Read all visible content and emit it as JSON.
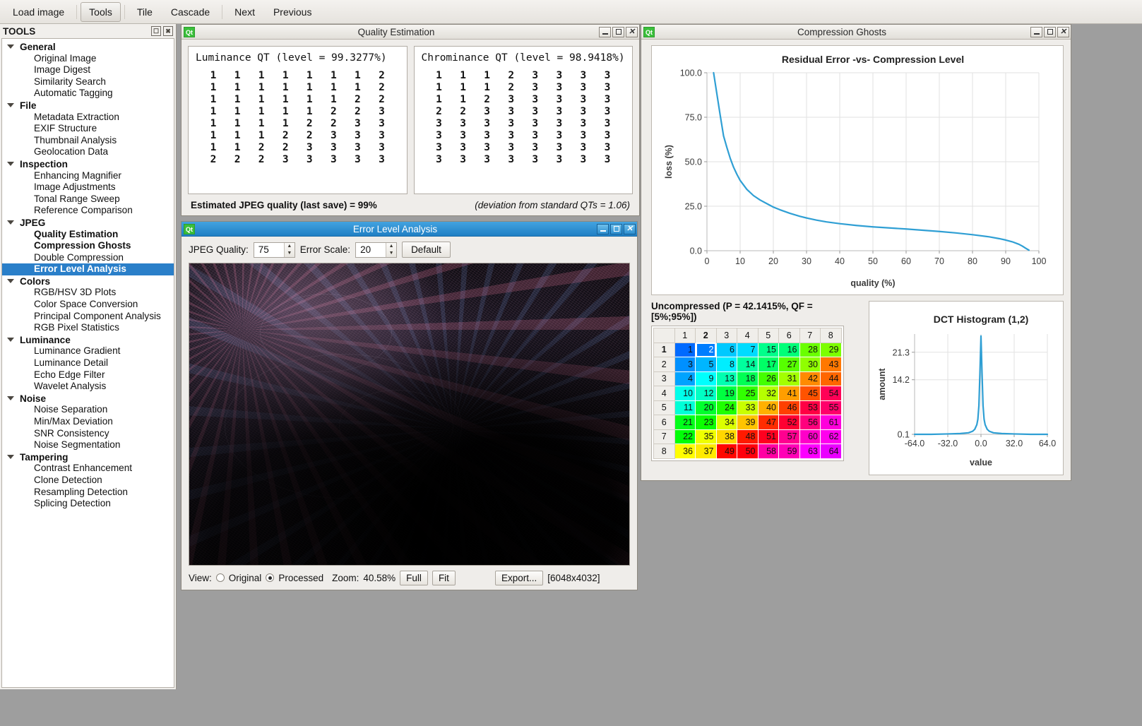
{
  "menubar": {
    "items": [
      {
        "label": "Load image",
        "active": false
      },
      {
        "label": "Tools",
        "active": true
      },
      {
        "label": "Tile",
        "active": false
      },
      {
        "label": "Cascade",
        "active": false
      },
      {
        "label": "Next",
        "active": false
      },
      {
        "label": "Previous",
        "active": false
      }
    ]
  },
  "tools_dock": {
    "title": "TOOLS",
    "float_icon": "float-icon",
    "close_icon": "close-icon",
    "groups": [
      {
        "name": "General",
        "items": [
          "Original Image",
          "Image Digest",
          "Similarity Search",
          "Automatic Tagging"
        ]
      },
      {
        "name": "File",
        "items": [
          "Metadata Extraction",
          "EXIF Structure",
          "Thumbnail Analysis",
          "Geolocation Data"
        ]
      },
      {
        "name": "Inspection",
        "items": [
          "Enhancing Magnifier",
          "Image Adjustments",
          "Tonal Range Sweep",
          "Reference Comparison"
        ]
      },
      {
        "name": "JPEG",
        "items": [
          "Quality Estimation",
          "Compression Ghosts",
          "Double Compression",
          "Error Level Analysis"
        ]
      },
      {
        "name": "Colors",
        "items": [
          "RGB/HSV 3D Plots",
          "Color Space Conversion",
          "Principal Component Analysis",
          "RGB Pixel Statistics"
        ]
      },
      {
        "name": "Luminance",
        "items": [
          "Luminance Gradient",
          "Luminance Detail",
          "Echo Edge Filter",
          "Wavelet Analysis"
        ]
      },
      {
        "name": "Noise",
        "items": [
          "Noise Separation",
          "Min/Max Deviation",
          "SNR Consistency",
          "Noise Segmentation"
        ]
      },
      {
        "name": "Tampering",
        "items": [
          "Contrast Enhancement",
          "Clone Detection",
          "Resampling Detection",
          "Splicing Detection"
        ]
      }
    ],
    "bold_items": [
      "Quality Estimation",
      "Compression Ghosts"
    ],
    "selected_item": "Error Level Analysis",
    "selected_color": "#2a7fc9"
  },
  "quality_estimation": {
    "window_title": "Quality Estimation",
    "qt_badge": "Qt",
    "luminance": {
      "title": "Luminance QT (level = 99.3277%)",
      "matrix": [
        [
          1,
          1,
          1,
          1,
          1,
          1,
          1,
          2
        ],
        [
          1,
          1,
          1,
          1,
          1,
          1,
          1,
          2
        ],
        [
          1,
          1,
          1,
          1,
          1,
          1,
          2,
          2
        ],
        [
          1,
          1,
          1,
          1,
          1,
          2,
          2,
          3
        ],
        [
          1,
          1,
          1,
          1,
          2,
          2,
          3,
          3
        ],
        [
          1,
          1,
          1,
          2,
          2,
          3,
          3,
          3
        ],
        [
          1,
          1,
          2,
          2,
          3,
          3,
          3,
          3
        ],
        [
          2,
          2,
          2,
          3,
          3,
          3,
          3,
          3
        ]
      ]
    },
    "chrominance": {
      "title": "Chrominance QT (level = 98.9418%)",
      "matrix": [
        [
          1,
          1,
          1,
          2,
          3,
          3,
          3,
          3
        ],
        [
          1,
          1,
          1,
          2,
          3,
          3,
          3,
          3
        ],
        [
          1,
          1,
          2,
          3,
          3,
          3,
          3,
          3
        ],
        [
          2,
          2,
          3,
          3,
          3,
          3,
          3,
          3
        ],
        [
          3,
          3,
          3,
          3,
          3,
          3,
          3,
          3
        ],
        [
          3,
          3,
          3,
          3,
          3,
          3,
          3,
          3
        ],
        [
          3,
          3,
          3,
          3,
          3,
          3,
          3,
          3
        ],
        [
          3,
          3,
          3,
          3,
          3,
          3,
          3,
          3
        ]
      ]
    },
    "footer_left": "Estimated JPEG quality (last save) = 99%",
    "footer_right": "(deviation from standard QTs = 1.06)",
    "buttons": {
      "minimize": "minimize-icon",
      "maximize": "maximize-icon",
      "close": "close-icon"
    }
  },
  "error_level_analysis": {
    "window_title": "Error Level Analysis",
    "qt_badge": "Qt",
    "jpeg_quality_label": "JPEG Quality:",
    "jpeg_quality_value": "75",
    "error_scale_label": "Error Scale:",
    "error_scale_value": "20",
    "default_button": "Default",
    "view_label": "View:",
    "view_original": "Original",
    "view_processed": "Processed",
    "view_selected": "Processed",
    "zoom_label": "Zoom:",
    "zoom_value": "40.58%",
    "full_button": "Full",
    "fit_button": "Fit",
    "export_button": "Export...",
    "dimensions": "[6048x4032]",
    "buttons": {
      "minimize": "minimize-icon",
      "maximize": "maximize-icon",
      "close": "close-icon"
    }
  },
  "compression_ghosts": {
    "window_title": "Compression Ghosts",
    "qt_badge": "Qt",
    "table_caption": "Uncompressed (P = 42.1415%, QF = [5%;95%])",
    "column_headers": [
      "1",
      "2",
      "3",
      "4",
      "5",
      "6",
      "7",
      "8"
    ],
    "row_headers": [
      "1",
      "2",
      "3",
      "4",
      "5",
      "6",
      "7",
      "8"
    ],
    "highlight_col": "2",
    "highlight_row": "1",
    "dct_table": [
      [
        1,
        2,
        6,
        7,
        15,
        16,
        28,
        29
      ],
      [
        3,
        5,
        8,
        14,
        17,
        27,
        30,
        43
      ],
      [
        4,
        9,
        13,
        18,
        26,
        31,
        42,
        44
      ],
      [
        10,
        12,
        19,
        25,
        32,
        41,
        45,
        54
      ],
      [
        11,
        20,
        24,
        33,
        40,
        46,
        53,
        55
      ],
      [
        21,
        23,
        34,
        39,
        47,
        52,
        56,
        61
      ],
      [
        22,
        35,
        38,
        48,
        51,
        57,
        60,
        62
      ],
      [
        36,
        37,
        49,
        50,
        58,
        59,
        63,
        64
      ]
    ],
    "selected_cell": {
      "row": 1,
      "col": 2,
      "value": 2
    },
    "buttons": {
      "minimize": "minimize-icon",
      "maximize": "maximize-icon",
      "close": "close-icon"
    }
  },
  "chart_data": [
    {
      "type": "line",
      "title": "Residual Error -vs- Compression Level",
      "xlabel": "quality (%)",
      "ylabel": "loss (%)",
      "xlim": [
        0,
        100
      ],
      "ylim": [
        0,
        100
      ],
      "xticks": [
        0,
        10,
        20,
        30,
        40,
        50,
        60,
        70,
        80,
        90,
        100
      ],
      "yticks": [
        0.0,
        25.0,
        50.0,
        75.0,
        100.0
      ],
      "ytick_labels": [
        "0.0",
        "25.0",
        "50.0",
        "75.0",
        "100.0"
      ],
      "grid": true,
      "legend": "none",
      "line_color": "#2f9fd4",
      "series": [
        {
          "name": "loss",
          "x": [
            2,
            3,
            4,
            5,
            6,
            7,
            8,
            9,
            10,
            12,
            14,
            16,
            18,
            20,
            22,
            25,
            28,
            30,
            33,
            36,
            40,
            45,
            50,
            55,
            60,
            65,
            70,
            75,
            80,
            85,
            88,
            90,
            92,
            94,
            95,
            96,
            97
          ],
          "y": [
            100.0,
            88.0,
            76.0,
            64.5,
            58.0,
            52.0,
            47.0,
            43.0,
            39.5,
            34.5,
            31.0,
            28.5,
            26.5,
            24.5,
            23.0,
            21.0,
            19.3,
            18.4,
            17.2,
            16.2,
            15.2,
            14.2,
            13.4,
            12.8,
            12.2,
            11.5,
            10.8,
            10.0,
            9.0,
            7.8,
            6.8,
            6.0,
            5.0,
            3.6,
            2.6,
            1.4,
            0.3
          ]
        }
      ]
    },
    {
      "type": "line",
      "title": "DCT Histogram (1,2)",
      "xlabel": "value",
      "ylabel": "amount",
      "xlim": [
        -64.0,
        64.0
      ],
      "xticks": [
        -64.0,
        -32.0,
        0.0,
        32.0,
        64.0
      ],
      "xtick_labels": [
        "-64.0",
        "-32.0",
        "0.0",
        "32.0",
        "64.0"
      ],
      "yticks": [
        0.1,
        14.2,
        21.3
      ],
      "ytick_labels": [
        "0.1",
        "14.2",
        "21.3"
      ],
      "grid": true,
      "legend": "none",
      "line_color": "#2f9fd4",
      "series": [
        {
          "name": "amount",
          "x": [
            -64,
            -48,
            -32,
            -20,
            -12,
            -8,
            -6,
            -4,
            -3,
            -2,
            -1,
            0,
            1,
            2,
            3,
            4,
            6,
            8,
            12,
            20,
            32,
            48,
            64
          ],
          "y": [
            0.1,
            0.1,
            0.2,
            0.3,
            0.5,
            0.9,
            1.4,
            2.6,
            4.0,
            7.5,
            16.0,
            25.5,
            16.0,
            7.5,
            4.0,
            2.6,
            1.4,
            0.9,
            0.5,
            0.3,
            0.2,
            0.1,
            0.1
          ]
        }
      ]
    }
  ],
  "colors": {
    "accent": "#2a7fc9",
    "chart_line": "#2f9fd4",
    "desktop": "#9e9e9e",
    "panel": "#f1efec"
  }
}
